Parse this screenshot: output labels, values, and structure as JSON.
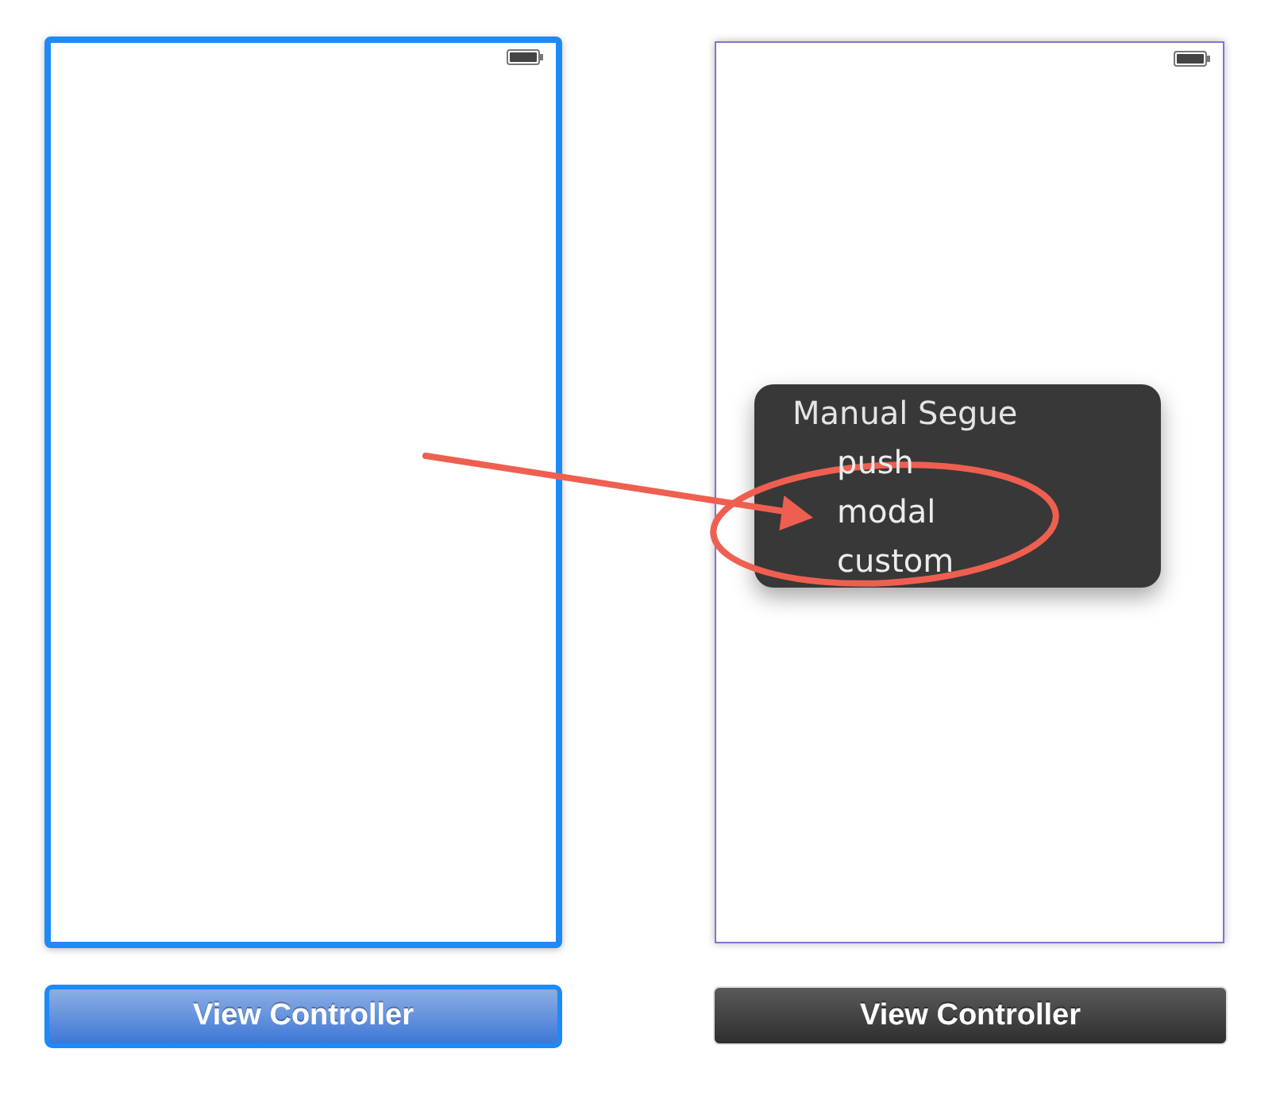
{
  "scenes": [
    {
      "title": "View Controller",
      "selected": true
    },
    {
      "title": "View Controller",
      "selected": false
    }
  ],
  "popup_menu": {
    "title": "Manual Segue",
    "items": [
      "push",
      "modal",
      "custom"
    ]
  }
}
